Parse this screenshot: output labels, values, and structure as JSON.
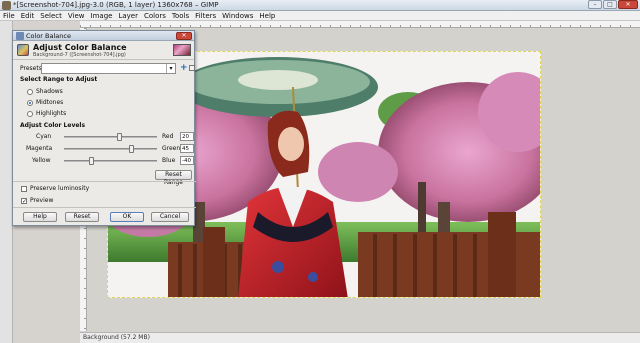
{
  "window": {
    "title": "*[Screenshot-704].jpg-3.0 (RGB, 1 layer) 1360x768 – GIMP",
    "minimize": "–",
    "maximize": "□",
    "close": "✕"
  },
  "menubar": {
    "items": [
      "File",
      "Edit",
      "Select",
      "View",
      "Image",
      "Layer",
      "Colors",
      "Tools",
      "Filters",
      "Windows",
      "Help"
    ]
  },
  "status": {
    "text": "Background (57.2 MB)"
  },
  "dialog": {
    "title": "Color Balance",
    "close": "✕",
    "header_title": "Adjust Color Balance",
    "header_subtitle": "Background-7 ([Screenshot-704].jpg)",
    "presets_label": "Presets:",
    "presets_value": "",
    "range_section": "Select Range to Adjust",
    "ranges": [
      {
        "label": "Shadows",
        "selected": false
      },
      {
        "label": "Midtones",
        "selected": true
      },
      {
        "label": "Highlights",
        "selected": false
      }
    ],
    "levels_section": "Adjust Color Levels",
    "sliders": [
      {
        "left": "Cyan",
        "right": "Red",
        "value": "20",
        "fraction": 0.6
      },
      {
        "left": "Magenta",
        "right": "Green",
        "value": "45",
        "fraction": 0.725
      },
      {
        "left": "Yellow",
        "right": "Blue",
        "value": "-40",
        "fraction": 0.3
      }
    ],
    "reset_range": "Reset Range",
    "preserve_luminosity": {
      "label": "Preserve luminosity",
      "checked": false
    },
    "preview": {
      "label": "Preview",
      "checked": true
    },
    "buttons": {
      "help": "Help",
      "reset": "Reset",
      "ok": "OK",
      "cancel": "Cancel"
    }
  },
  "colors": {
    "sky": "#f4f2f0",
    "blossom": "#d98cb8",
    "kimono": "#c8202a",
    "wood": "#7a3a22",
    "grass": "#4e8a3a"
  }
}
